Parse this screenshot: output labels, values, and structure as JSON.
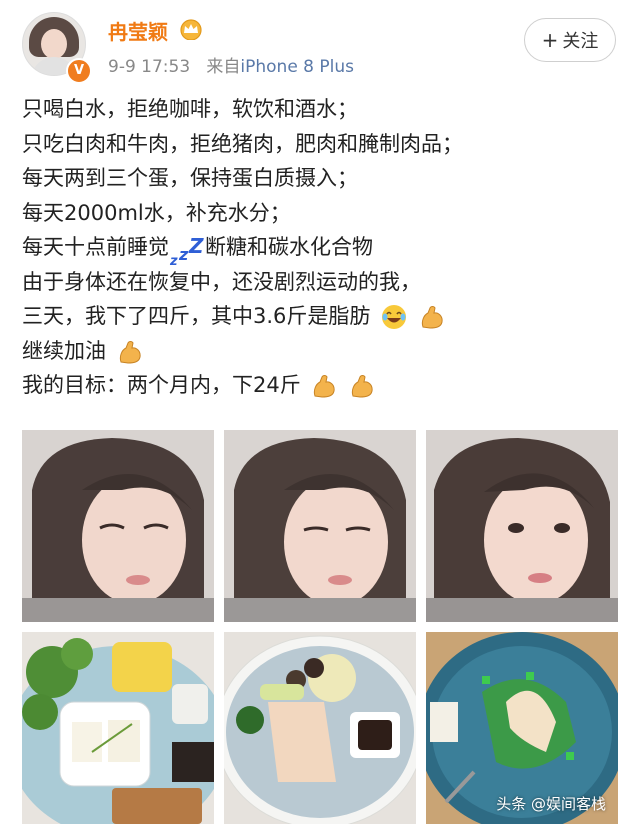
{
  "user": {
    "name": "冉莹颖",
    "badge_icon": "crown-icon",
    "verified_icon": "verified-v-icon",
    "verified_char": "V",
    "time": "9-9 17:53",
    "source_prefix": "来自",
    "source": "iPhone 8 Plus",
    "follow_plus": "+",
    "follow_label": "关注"
  },
  "post": {
    "lines": [
      "只喝白水，拒绝咖啡，软饮和酒水；",
      "只吃白肉和牛肉，拒绝猪肉，肥肉和腌制肉品；",
      "每天两到三个蛋，保持蛋白质摄入；",
      "每天2000ml水，补充水分；",
      "每天十点前睡觉",
      "断糖和碳水化合物",
      "由于身体还在恢复中，还没剧烈运动的我，",
      "三天，我下了四斤，其中3.6斤是脂肪",
      "继续加油",
      "我的目标：两个月内，下24斤"
    ],
    "zzz": [
      "z",
      "z",
      "Z"
    ]
  },
  "photos": [
    {
      "kind": "selfie",
      "name": "selfie-photo-1"
    },
    {
      "kind": "selfie",
      "name": "selfie-photo-2"
    },
    {
      "kind": "selfie",
      "name": "selfie-photo-3"
    },
    {
      "kind": "food",
      "name": "food-photo-tofu-broccoli"
    },
    {
      "kind": "food",
      "name": "food-photo-chicken-plate"
    },
    {
      "kind": "food",
      "name": "food-photo-chicken-greens"
    }
  ],
  "watermark": "头条 @娱间客栈",
  "colors": {
    "name": "#f07a14",
    "source": "#5a79a8",
    "zzz": "#2f5fd6"
  }
}
